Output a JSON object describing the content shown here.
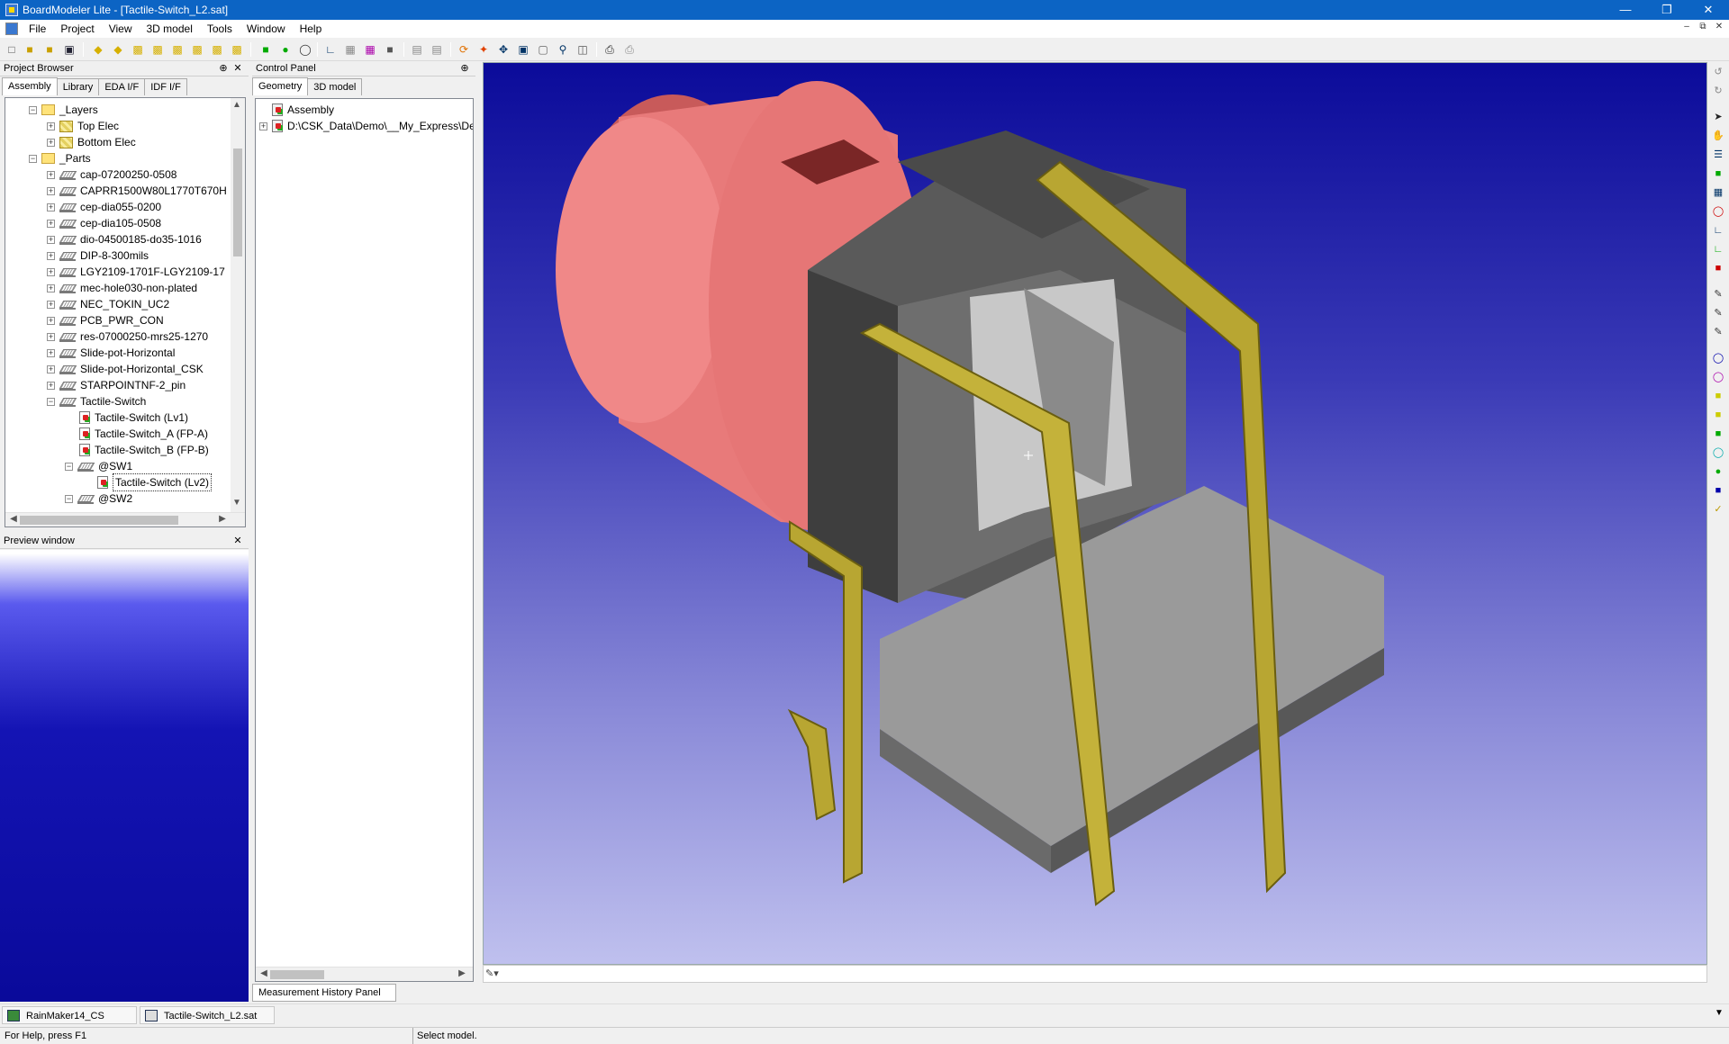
{
  "window": {
    "title": "BoardModeler Lite - [Tactile-Switch_L2.sat]",
    "minimize": "—",
    "restore": "❐",
    "close": "✕"
  },
  "menu": [
    "File",
    "Project",
    "View",
    "3D model",
    "Tools",
    "Window",
    "Help"
  ],
  "mdi_controls": {
    "min": "–",
    "restore": "⧉",
    "close": "✕"
  },
  "project_browser": {
    "title": "Project Browser",
    "tabs": [
      "Assembly",
      "Library",
      "EDA I/F",
      "IDF I/F"
    ],
    "tree": [
      {
        "label": "_Layers",
        "icon": "folder-icon",
        "level": 1,
        "exp": "−"
      },
      {
        "label": "Top Elec",
        "icon": "layer-icon",
        "level": 2,
        "exp": "+"
      },
      {
        "label": "Bottom Elec",
        "icon": "layer-icon",
        "level": 2,
        "exp": "+"
      },
      {
        "label": "_Parts",
        "icon": "folder-icon",
        "level": 1,
        "exp": "−"
      },
      {
        "label": "cap-07200250-0508",
        "icon": "part-icon",
        "level": 2,
        "exp": "+"
      },
      {
        "label": "CAPRR1500W80L1770T670H",
        "icon": "part-icon",
        "level": 2,
        "exp": "+"
      },
      {
        "label": "cep-dia055-0200",
        "icon": "part-icon",
        "level": 2,
        "exp": "+"
      },
      {
        "label": "cep-dia105-0508",
        "icon": "part-icon",
        "level": 2,
        "exp": "+"
      },
      {
        "label": "dio-04500185-do35-1016",
        "icon": "part-icon",
        "level": 2,
        "exp": "+"
      },
      {
        "label": "DIP-8-300mils",
        "icon": "part-icon",
        "level": 2,
        "exp": "+"
      },
      {
        "label": "LGY2109-1701F-LGY2109-17",
        "icon": "part-icon",
        "level": 2,
        "exp": "+"
      },
      {
        "label": "mec-hole030-non-plated",
        "icon": "part-icon",
        "level": 2,
        "exp": "+"
      },
      {
        "label": "NEC_TOKIN_UC2",
        "icon": "part-icon",
        "level": 2,
        "exp": "+"
      },
      {
        "label": "PCB_PWR_CON",
        "icon": "part-icon",
        "level": 2,
        "exp": "+"
      },
      {
        "label": "res-07000250-mrs25-1270",
        "icon": "part-icon",
        "level": 2,
        "exp": "+"
      },
      {
        "label": "Slide-pot-Horizontal",
        "icon": "part-icon",
        "level": 2,
        "exp": "+"
      },
      {
        "label": "Slide-pot-Horizontal_CSK",
        "icon": "part-icon",
        "level": 2,
        "exp": "+"
      },
      {
        "label": "STARPOINTNF-2_pin",
        "icon": "part-icon",
        "level": 2,
        "exp": "+"
      },
      {
        "label": "Tactile-Switch",
        "icon": "part-icon",
        "level": 2,
        "exp": "−"
      },
      {
        "label": "Tactile-Switch (Lv1)",
        "icon": "doc-icon",
        "level": 3,
        "exp": ""
      },
      {
        "label": "Tactile-Switch_A (FP-A)",
        "icon": "doc-icon",
        "level": 3,
        "exp": ""
      },
      {
        "label": "Tactile-Switch_B (FP-B)",
        "icon": "doc-icon",
        "level": 3,
        "exp": ""
      },
      {
        "label": "@SW1",
        "icon": "part-icon",
        "level": 3,
        "exp": "−"
      },
      {
        "label": "Tactile-Switch (Lv2)",
        "icon": "doc-icon",
        "level": 4,
        "exp": "",
        "selected": true
      },
      {
        "label": "@SW2",
        "icon": "part-icon",
        "level": 3,
        "exp": "−"
      }
    ]
  },
  "preview": {
    "title": "Preview window"
  },
  "control_panel": {
    "title": "Control Panel",
    "tabs": [
      "Geometry",
      "3D model"
    ],
    "tree": [
      {
        "label": "Assembly",
        "exp": ""
      },
      {
        "label": "D:\\CSK_Data\\Demo\\__My_Express\\De",
        "exp": "+"
      }
    ]
  },
  "measurement_tab": "Measurement History Panel",
  "taskbar": [
    "RainMaker14_CS",
    "Tactile-Switch_L2.sat"
  ],
  "status": {
    "left": "For Help, press F1",
    "right": "Select model."
  },
  "colors": {
    "titlebar": "#0c64c4",
    "cap": "#e87878",
    "body": "#6a6a6a",
    "pins": "#b8a632"
  }
}
